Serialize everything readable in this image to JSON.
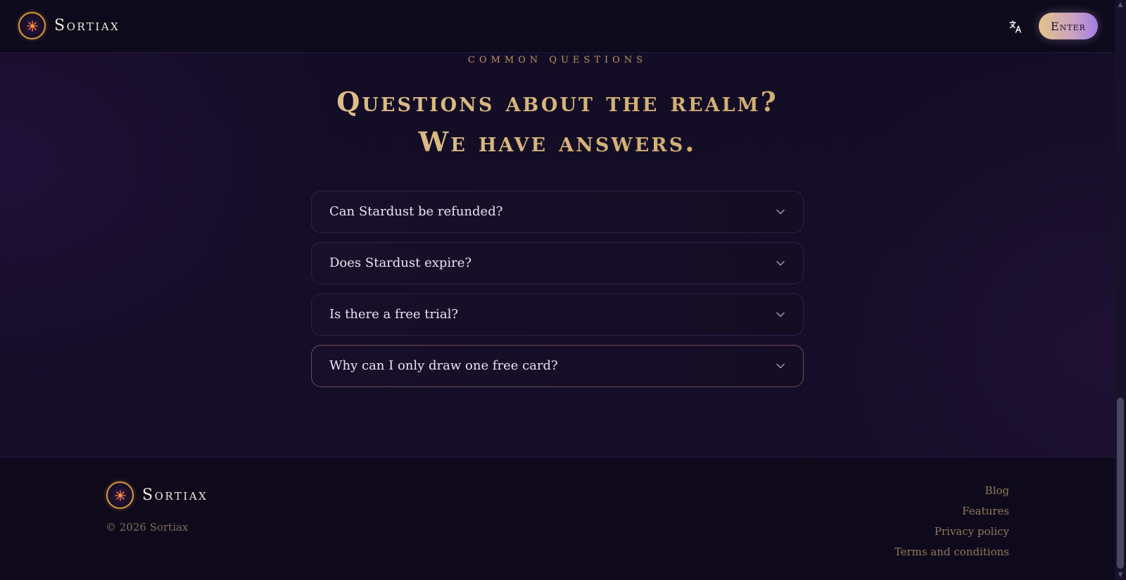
{
  "header": {
    "brand_name": "Sortiax",
    "enter_label": "Enter",
    "translate_icon": "translate-icon"
  },
  "faq": {
    "eyebrow": "COMMON QUESTIONS",
    "title_line1": "Questions about the realm?",
    "title_line2": "We have answers.",
    "items": [
      {
        "question": "Can Stardust be refunded?"
      },
      {
        "question": "Does Stardust expire?"
      },
      {
        "question": "Is there a free trial?"
      },
      {
        "question": "Why can I only draw one free card?"
      }
    ]
  },
  "footer": {
    "brand_name": "Sortiax",
    "copyright": "© 2026 Sortiax",
    "links": [
      "Blog",
      "Features",
      "Privacy policy",
      "Terms and conditions"
    ]
  },
  "colors": {
    "background": "#140d26",
    "gold_accent": "#d9bd83",
    "button_gradient_start": "#e2c48a",
    "button_gradient_end": "#a27de6"
  }
}
